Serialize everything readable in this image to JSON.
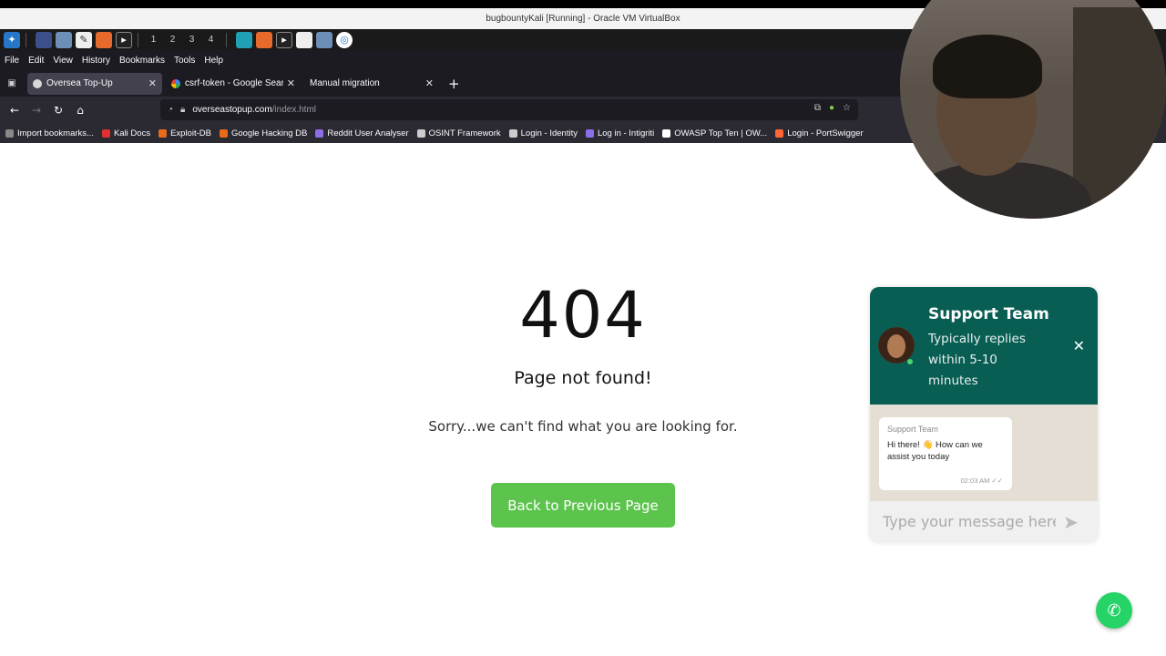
{
  "vm_window": {
    "title": "bugbountyKali [Running] - Oracle VM VirtualBox"
  },
  "taskbar": {
    "workspaces": [
      "1",
      "2",
      "3",
      "4"
    ]
  },
  "menubar": {
    "items": [
      "File",
      "Edit",
      "View",
      "History",
      "Bookmarks",
      "Tools",
      "Help"
    ]
  },
  "tabs": [
    {
      "label": "Oversea Top-Up",
      "active": true
    },
    {
      "label": "csrf-token - Google Searc",
      "active": false
    },
    {
      "label": "Manual migration",
      "active": false
    }
  ],
  "urlbar": {
    "host": "overseastopup.com",
    "path": "/index.html"
  },
  "bookmarks": [
    {
      "label": "Import bookmarks...",
      "color": "#888888"
    },
    {
      "label": "Kali Docs",
      "color": "#e0312f"
    },
    {
      "label": "Exploit-DB",
      "color": "#e86a1b"
    },
    {
      "label": "Google Hacking DB",
      "color": "#e86a1b"
    },
    {
      "label": "Reddit User Analyser",
      "color": "#8d6ee8"
    },
    {
      "label": "OSINT Framework",
      "color": "#cccccc"
    },
    {
      "label": "Login - Identity",
      "color": "#cccccc"
    },
    {
      "label": "Log in - Intigriti",
      "color": "#8d6ee8"
    },
    {
      "label": "OWASP Top Ten | OW...",
      "color": "#ffffff"
    },
    {
      "label": "Login - PortSwigger",
      "color": "#ff6633"
    }
  ],
  "page": {
    "error_code": "404",
    "title": "Page not found!",
    "subtitle": "Sorry...we can't find what you are looking for.",
    "back_button": "Back to Previous Page"
  },
  "chat_widget": {
    "name": "Support Team",
    "status": "Typically replies within 5-10 minutes",
    "message": {
      "sender": "Support Team",
      "text": "Hi there! 👋 How can we assist you today",
      "time": "02:03 AM"
    },
    "input_placeholder": "Type your message here"
  },
  "colors": {
    "chat_header": "#095e54",
    "back_button": "#5cc34d",
    "whatsapp": "#25d366"
  }
}
